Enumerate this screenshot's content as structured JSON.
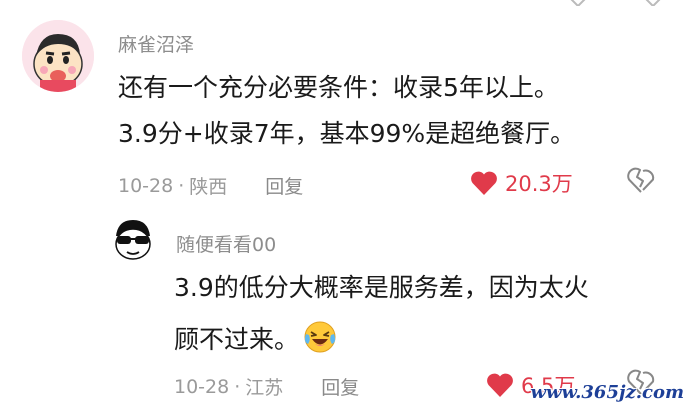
{
  "comment": {
    "username": "麻雀沼泽",
    "lines": [
      "还有一个充分必要条件：收录5年以上。",
      "3.9分+收录7年，基本99%是超绝餐厅。"
    ],
    "date": "10-28",
    "dot": "·",
    "location": "陕西",
    "reply_label": "回复",
    "likes": "20.3万",
    "avatar_icon": "crayon-shinchan-avatar",
    "like_icon": "heart-icon",
    "dislike_icon": "broken-heart-icon"
  },
  "reply": {
    "username": "随便看看00",
    "lines": [
      "3.9的低分大概率是服务差，因为太火",
      "顾不过来。"
    ],
    "emoji": "laughing-crying-emoji",
    "date": "10-28",
    "dot": "·",
    "location": "江苏",
    "reply_label": "回复",
    "likes": "6.5万",
    "avatar_icon": "sunglasses-cartoon-avatar"
  },
  "watermark": "www.365jz.com",
  "colors": {
    "like_red": "#e03a4a",
    "meta_gray": "#9a9a9a",
    "text_dark": "#1a1a1a",
    "watermark_blue": "#1d3f97"
  }
}
